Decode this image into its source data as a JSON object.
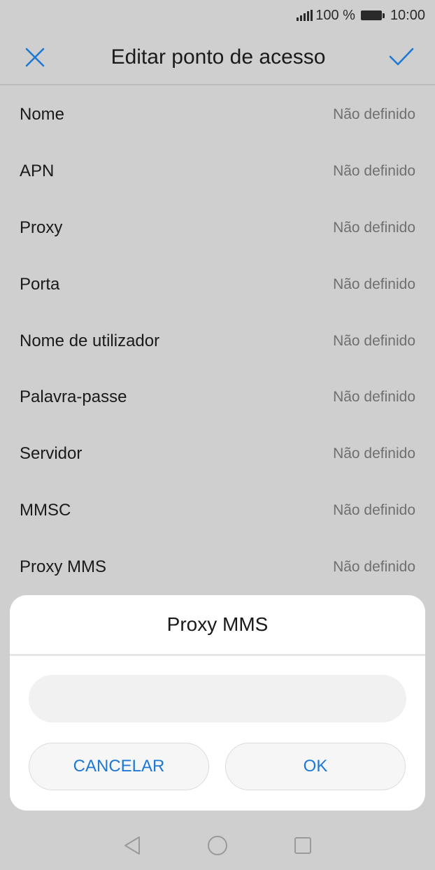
{
  "status_bar": {
    "signal_icon": "signal-icon",
    "battery_percent": "100 %",
    "battery_icon": "battery-icon",
    "time": "10:00"
  },
  "app_bar": {
    "title": "Editar ponto de acesso",
    "close_icon": "close-icon",
    "confirm_icon": "check-icon",
    "accent_color": "#1e78d4"
  },
  "settings": [
    {
      "label": "Nome",
      "value": "Não definido"
    },
    {
      "label": "APN",
      "value": "Não definido"
    },
    {
      "label": "Proxy",
      "value": "Não definido"
    },
    {
      "label": "Porta",
      "value": "Não definido"
    },
    {
      "label": "Nome de utilizador",
      "value": "Não definido"
    },
    {
      "label": "Palavra-passe",
      "value": "Não definido"
    },
    {
      "label": "Servidor",
      "value": "Não definido"
    },
    {
      "label": "MMSC",
      "value": "Não definido"
    },
    {
      "label": "Proxy MMS",
      "value": "Não definido"
    }
  ],
  "dialog": {
    "title": "Proxy MMS",
    "input_value": "",
    "cancel_label": "CANCELAR",
    "ok_label": "OK"
  },
  "nav_bar": {
    "back_icon": "back-triangle-icon",
    "home_icon": "home-circle-icon",
    "recents_icon": "recents-square-icon"
  }
}
